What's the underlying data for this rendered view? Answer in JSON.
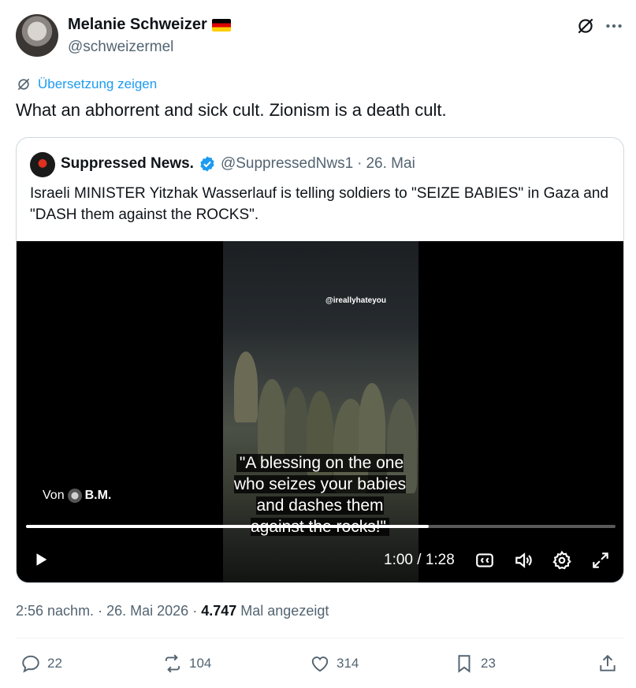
{
  "author": {
    "name": "Melanie Schweizer",
    "handle": "@schweizermel"
  },
  "translate_label": "Übersetzung zeigen",
  "tweet_text": "What an abhorrent and sick cult. Zionism is a death cult.",
  "quote": {
    "name": "Suppressed News.",
    "handle": "@SuppressedNws1",
    "dot": "·",
    "date": "26. Mai",
    "text": "Israeli MINISTER Yitzhak Wasserlauf is telling soldiers to \"SEIZE BABIES\" in Gaza and \"DASH them against the ROCKS\".",
    "video": {
      "watermark": "@ireallyhateyou",
      "caption": "\"A blessing on the one who seizes your babies and dashes them against the rocks!\"",
      "credit_prefix": "Von",
      "credit_name": "B.M.",
      "time": "1:00 / 1:28",
      "progress": 0.683
    }
  },
  "meta": {
    "time": "2:56 nachm.",
    "sep1": "·",
    "date": "26. Mai 2026",
    "sep2": "·",
    "views": "4.747",
    "views_label": "Mal angezeigt"
  },
  "actions": {
    "replies": "22",
    "reposts": "104",
    "likes": "314",
    "bookmarks": "23"
  },
  "colors": {
    "accent": "#1d9bf0",
    "secondary_text": "#536471",
    "border": "#cfd9de"
  }
}
